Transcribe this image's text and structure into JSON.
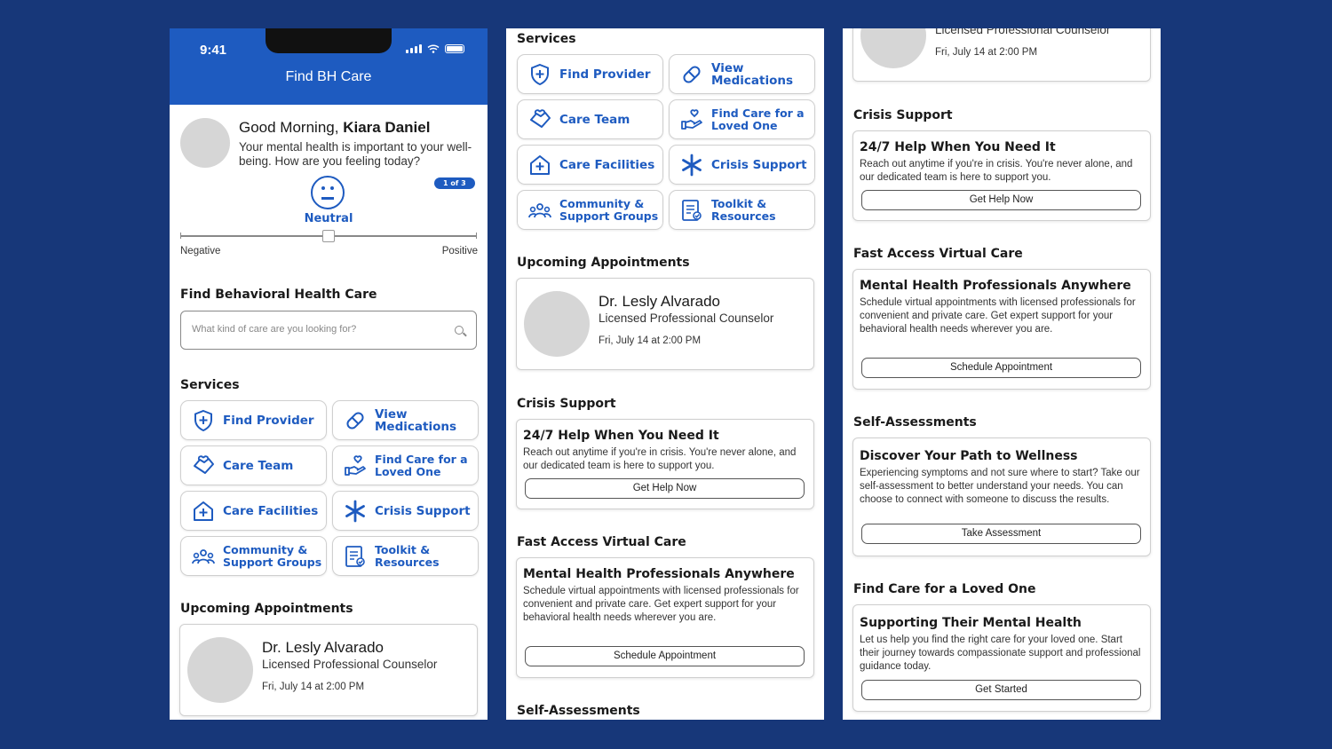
{
  "phone": {
    "time": "9:41",
    "title": "Find BH Care"
  },
  "greeting": {
    "prefix": "Good Morning, ",
    "name": "Kiara Daniel",
    "message": "Your mental health is important to your well-being. How are you feeling today?",
    "mood": "Neutral",
    "step": "1 of 3",
    "slider_value": 0.5,
    "negative_label": "Negative",
    "positive_label": "Positive"
  },
  "search": {
    "heading": "Find Behavioral Health Care",
    "placeholder": "What kind of care are you looking for?"
  },
  "services": {
    "heading": "Services",
    "items": [
      {
        "label": "Find Provider",
        "icon": "shield-plus-icon"
      },
      {
        "label": "View Medications",
        "icon": "pill-icon"
      },
      {
        "label": "Care Team",
        "icon": "handshake-heart-icon"
      },
      {
        "label": "Find Care for a Loved One",
        "icon": "hand-heart-icon"
      },
      {
        "label": "Care Facilities",
        "icon": "facility-plus-icon"
      },
      {
        "label": "Crisis Support",
        "icon": "asterisk-icon"
      },
      {
        "label": "Community & Support Groups",
        "icon": "people-group-icon"
      },
      {
        "label": "Toolkit & Resources",
        "icon": "document-list-icon"
      }
    ]
  },
  "appointments": {
    "heading": "Upcoming Appointments",
    "doctor": "Dr. Lesly Alvarado",
    "role": "Licensed Professional Counselor",
    "when": "Fri, July 14 at 2:00 PM"
  },
  "crisis": {
    "heading": "Crisis Support",
    "title": "24/7 Help When You Need It",
    "body": "Reach out anytime if you're in crisis. You're never alone, and our dedicated team is here to support you.",
    "button": "Get Help Now"
  },
  "virtual": {
    "heading": "Fast Access Virtual Care",
    "title": "Mental Health Professionals Anywhere",
    "body": "Schedule virtual appointments with licensed professionals for convenient and private care. Get expert support for your behavioral health needs wherever you are.",
    "button": "Schedule Appointment"
  },
  "assessments": {
    "heading": "Self-Assessments",
    "title": "Discover Your Path to Wellness",
    "body": "Experiencing symptoms and not sure where to start? Take our self-assessment to better understand your needs. You can choose to connect with someone to discuss the results.",
    "button": "Take Assessment"
  },
  "loved_one": {
    "heading": "Find Care for a Loved One",
    "title": "Supporting Their Mental Health",
    "body": "Let us help you find the right care for your loved one. Start their journey towards compassionate support and professional guidance today.",
    "button": "Get Started"
  },
  "colors": {
    "primary": "#1e5bc0",
    "background": "#173779",
    "avatar": "#d6d6d6"
  }
}
